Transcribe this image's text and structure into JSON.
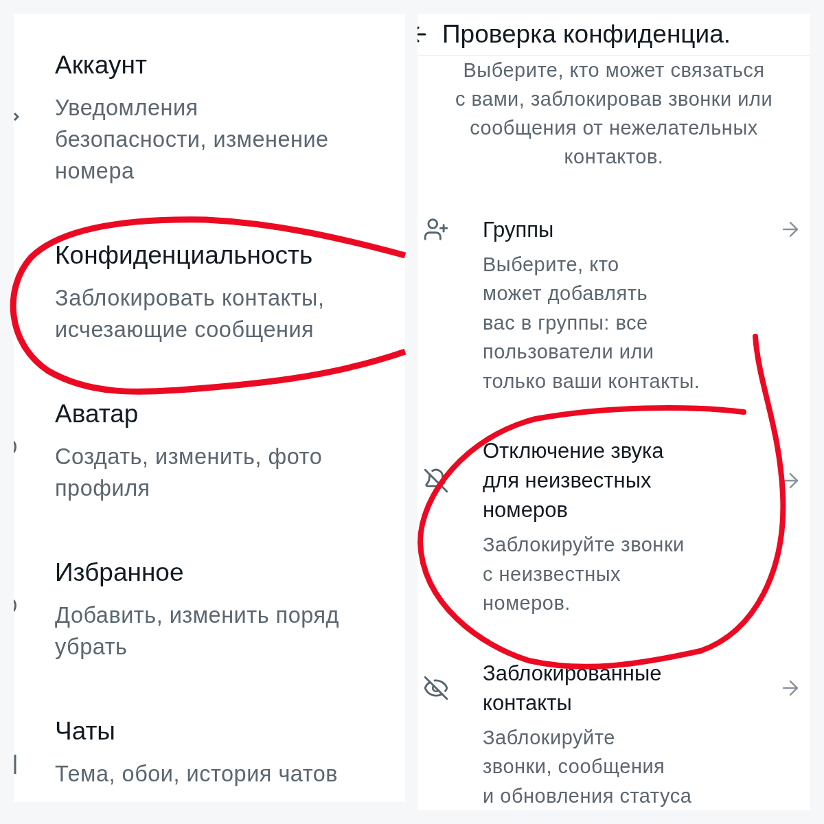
{
  "settings": {
    "items": [
      {
        "title": "Аккаунт",
        "subtitle_lines": [
          "Уведомления",
          "безопасности, изменение",
          "номера"
        ],
        "kind": "chevron"
      },
      {
        "title": "Конфиденциальность",
        "subtitle_lines": [
          "Заблокировать контакты,",
          "исчезающие сообщения"
        ],
        "kind": "plain"
      },
      {
        "title": "Аватар",
        "subtitle_lines": [
          "Создать, изменить, фото",
          "профиля"
        ],
        "kind": "arc"
      },
      {
        "title": "Избранное",
        "subtitle_lines": [
          "Добавить, изменить поряд",
          "убрать"
        ],
        "kind": "arc"
      },
      {
        "title": "Чаты",
        "subtitle_lines": [
          "Тема, обои, история чатов"
        ],
        "kind": "bar"
      }
    ]
  },
  "privacy_checkup": {
    "title": "Проверка конфиденциа.",
    "intro_lines": [
      "Выберите, кто может связаться",
      "с вами, заблокировав звонки или",
      "сообщения от нежелательных",
      "контактов."
    ],
    "items": [
      {
        "kind": "groups",
        "title_lines": [
          "Группы"
        ],
        "subtitle_lines": [
          "Выберите, кто",
          "может добавлять",
          "вас в группы: все",
          "пользователи или",
          "только ваши контакты."
        ]
      },
      {
        "kind": "silence",
        "title_lines": [
          "Отключение звука",
          "для неизвестных",
          "номеров"
        ],
        "subtitle_lines": [
          "Заблокируйте звонки",
          "с неизвестных",
          "номеров."
        ]
      },
      {
        "kind": "blocked",
        "title_lines": [
          "Заблокированные",
          "контакты"
        ],
        "subtitle_lines": [
          "Заблокируйте",
          "звонки, сообщения",
          "и обновления статуса"
        ]
      }
    ]
  }
}
